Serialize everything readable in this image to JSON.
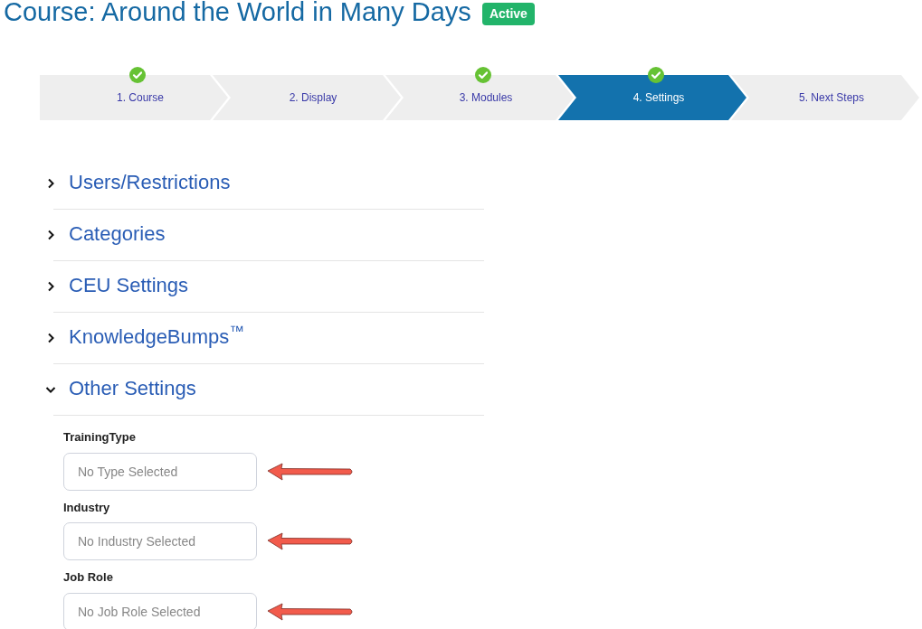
{
  "title": "Course: Around the World in Many Days",
  "status_badge": "Active",
  "steps": [
    {
      "label": "1. Course",
      "completed": true,
      "selected": false
    },
    {
      "label": "2. Display",
      "completed": false,
      "selected": false
    },
    {
      "label": "3. Modules",
      "completed": true,
      "selected": false
    },
    {
      "label": "4. Settings",
      "completed": true,
      "selected": true
    },
    {
      "label": "5. Next Steps",
      "completed": false,
      "selected": false
    }
  ],
  "sections": [
    {
      "title": "Users/Restrictions",
      "expanded": false
    },
    {
      "title": "Categories",
      "expanded": false
    },
    {
      "title": "CEU Settings",
      "expanded": false
    },
    {
      "title": "KnowledgeBumps$^{™}$",
      "expanded": false
    },
    {
      "title": "Other Settings",
      "expanded": true
    }
  ],
  "other_settings_fields": [
    {
      "label": "TrainingType",
      "placeholder": "No Type Selected"
    },
    {
      "label": "Industry",
      "placeholder": "No Industry Selected"
    },
    {
      "label": "Job Role",
      "placeholder": "No Job Role Selected"
    }
  ]
}
